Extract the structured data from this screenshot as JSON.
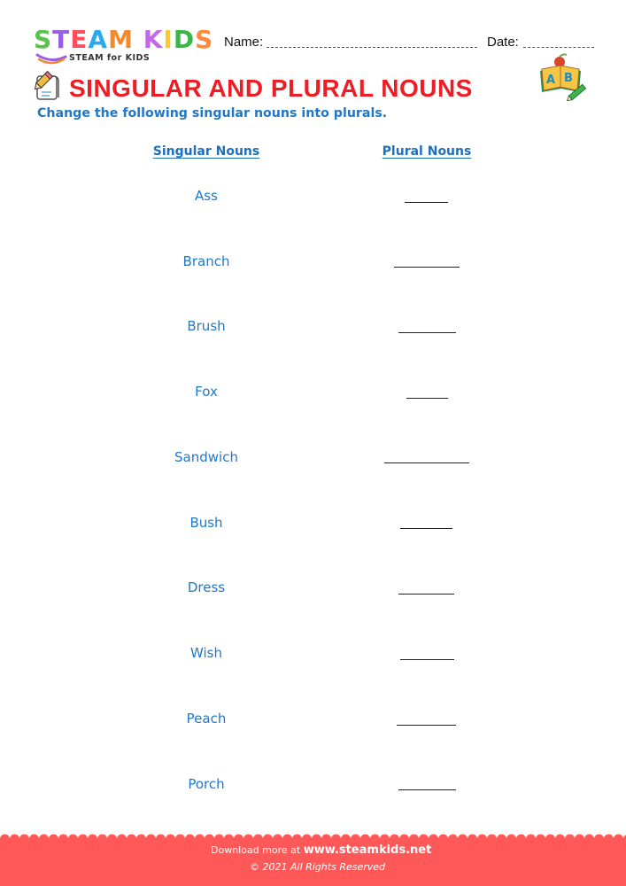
{
  "brand": {
    "logo_letters": [
      {
        "char": "S",
        "color": "#5cc24f"
      },
      {
        "char": "T",
        "color": "#9a5de8"
      },
      {
        "char": "E",
        "color": "#ff4f5a"
      },
      {
        "char": "A",
        "color": "#28a8f0"
      },
      {
        "char": "M",
        "color": "#f08a2c"
      },
      {
        "char": " ",
        "color": "#ffffff"
      },
      {
        "char": "K",
        "color": "#c368e6"
      },
      {
        "char": "I",
        "color": "#ffc928"
      },
      {
        "char": "D",
        "color": "#3cb54a"
      },
      {
        "char": "S",
        "color": "#ff8a3c"
      }
    ],
    "tagline": "STEAM for KIDS"
  },
  "header": {
    "name_label": "Name:",
    "date_label": "Date:"
  },
  "worksheet": {
    "title": "SINGULAR AND PLURAL NOUNS",
    "instructions": "Change the following singular nouns into plurals.",
    "columns": {
      "singular": "Singular Nouns",
      "plural": "Plural Nouns"
    },
    "nouns": [
      "Ass",
      "Branch",
      "Brush",
      "Fox",
      "Sandwich",
      "Bush",
      "Dress",
      "Wish",
      "Peach",
      "Porch"
    ],
    "answers": [
      "",
      "",
      "",
      "",
      "",
      "",
      "",
      "",
      "",
      ""
    ]
  },
  "footer": {
    "download_text": "Download more at",
    "website": "www.steamkids.net",
    "copyright": "© 2021 All Rights Reserved"
  },
  "colors": {
    "title_red": "#ee1c25",
    "text_blue": "#1f78c8",
    "footer_red": "#ff5858"
  }
}
